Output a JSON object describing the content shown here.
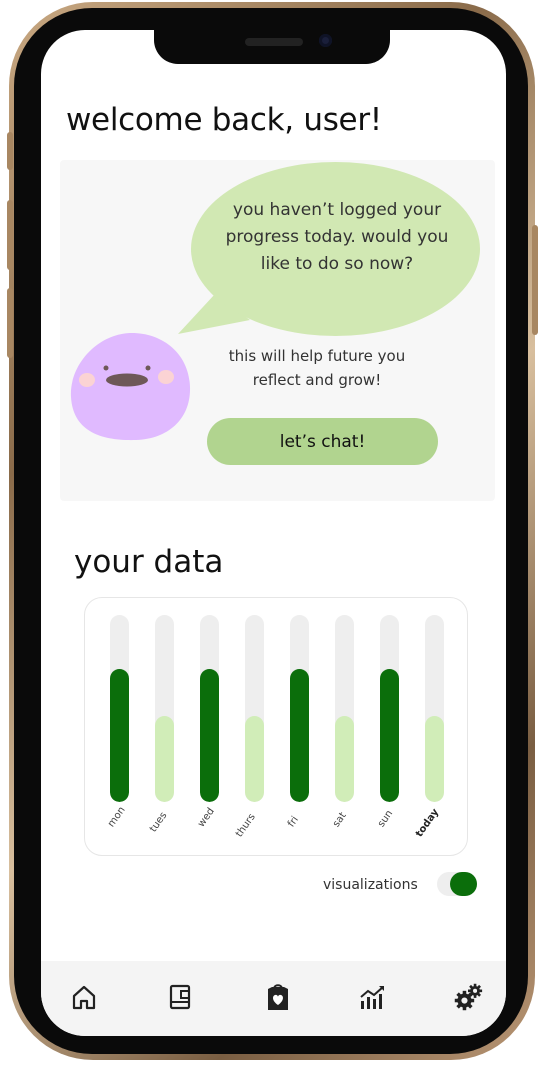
{
  "header": {
    "title": "welcome back, user!"
  },
  "prompt": {
    "bubble_text": "you haven’t logged your progress today. would you like to do so now?",
    "help_text": "this will help future you reflect and grow!",
    "chat_button": "let’s chat!"
  },
  "data_section": {
    "title": "your data"
  },
  "chart_data": {
    "type": "bar",
    "categories": [
      "mon",
      "tues",
      "wed",
      "thurs",
      "fri",
      "sat",
      "sun",
      "today"
    ],
    "values": [
      0.71,
      0.46,
      0.71,
      0.46,
      0.71,
      0.46,
      0.71,
      0.46
    ],
    "ylim": [
      0,
      1
    ],
    "highlighted_category": "today",
    "colors": {
      "high": "#0b6e0b",
      "low": "#d1edb8",
      "track": "#eeeeee"
    }
  },
  "visualizations": {
    "label": "visualizations",
    "enabled": true
  },
  "nav": [
    {
      "name": "home",
      "icon": "home-icon"
    },
    {
      "name": "journal",
      "icon": "journal-icon"
    },
    {
      "name": "self-care",
      "icon": "heart-bag-icon"
    },
    {
      "name": "stats",
      "icon": "stats-icon"
    },
    {
      "name": "settings",
      "icon": "gears-icon"
    }
  ],
  "colors": {
    "bubble": "#d1e8b3",
    "button": "#b1d48f",
    "avatar": "#e0baff",
    "accent": "#0b6e0b"
  }
}
